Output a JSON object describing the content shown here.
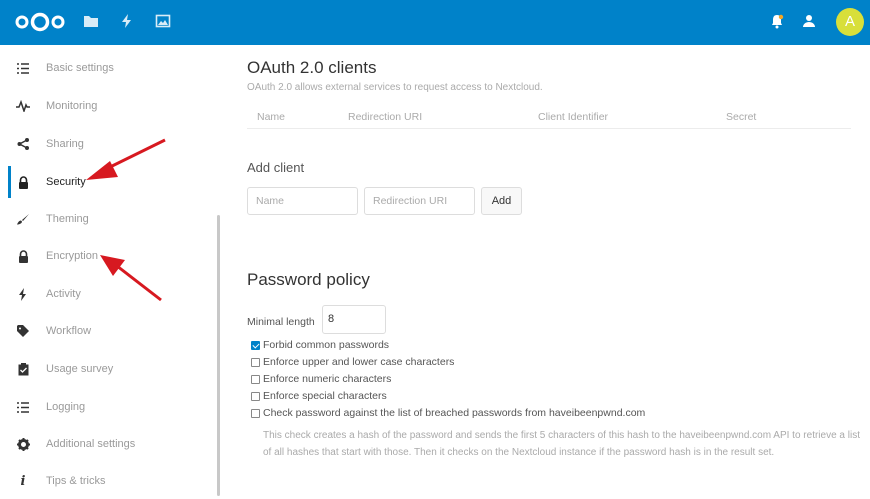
{
  "header": {
    "avatar_letter": "A",
    "brand_color": "#0082c9",
    "apps": [
      "files-icon",
      "activity-icon",
      "gallery-icon"
    ],
    "right_icons": [
      "notifications-icon",
      "contacts-icon"
    ]
  },
  "sidebar": {
    "items": [
      {
        "label": "Basic settings",
        "icon": "list-icon"
      },
      {
        "label": "Monitoring",
        "icon": "pulse-icon"
      },
      {
        "label": "Sharing",
        "icon": "share-icon"
      },
      {
        "label": "Security",
        "icon": "lock-icon",
        "active": true
      },
      {
        "label": "Theming",
        "icon": "brush-icon"
      },
      {
        "label": "Encryption",
        "icon": "lock-icon"
      },
      {
        "label": "Activity",
        "icon": "lightning-icon"
      },
      {
        "label": "Workflow",
        "icon": "tag-icon"
      },
      {
        "label": "Usage survey",
        "icon": "clipboard-icon"
      },
      {
        "label": "Logging",
        "icon": "list-icon"
      },
      {
        "label": "Additional settings",
        "icon": "gear-icon"
      },
      {
        "label": "Tips & tricks",
        "icon": "info-icon"
      }
    ]
  },
  "oauth": {
    "title": "OAuth 2.0 clients",
    "description": "OAuth 2.0 allows external services to request access to Nextcloud.",
    "columns": [
      "Name",
      "Redirection URI",
      "Client Identifier",
      "Secret"
    ],
    "add_client_title": "Add client",
    "name_placeholder": "Name",
    "uri_placeholder": "Redirection URI",
    "add_label": "Add"
  },
  "password_policy": {
    "title": "Password policy",
    "min_length_label": "Minimal length",
    "min_length_value": "8",
    "options": [
      {
        "label": "Forbid common passwords",
        "checked": true
      },
      {
        "label": "Enforce upper and lower case characters",
        "checked": false
      },
      {
        "label": "Enforce numeric characters",
        "checked": false
      },
      {
        "label": "Enforce special characters",
        "checked": false
      },
      {
        "label": "Check password against the list of breached passwords from haveibeenpwnd.com",
        "checked": false
      }
    ],
    "hibp_description": "This check creates a hash of the password and sends the first 5 characters of this hash to the haveibeenpwnd.com API to retrieve a list of all hashes that start with those. Then it checks on the Nextcloud instance if the password hash is in the result set."
  }
}
